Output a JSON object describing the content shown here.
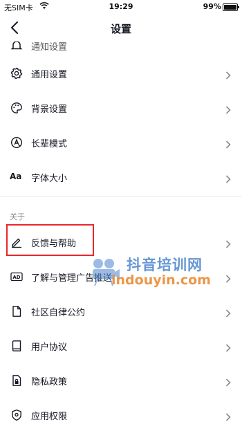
{
  "status_bar": {
    "carrier": "无SIM卡",
    "time": "19:29",
    "battery_percent": "99%",
    "battery_level": 0.99
  },
  "nav": {
    "title": "设置",
    "back_icon": "chevron-left-icon"
  },
  "list": {
    "partial_item": {
      "label": "通知设置",
      "icon": "bell-icon"
    },
    "items_general": [
      {
        "label": "通用设置",
        "icon": "gear-icon"
      },
      {
        "label": "背景设置",
        "icon": "palette-icon"
      },
      {
        "label": "长辈模式",
        "icon": "elder-mode-icon"
      },
      {
        "label": "字体大小",
        "icon": "font-size-icon",
        "icon_text": "Aa"
      }
    ],
    "about_header": "关于",
    "items_about": [
      {
        "label": "反馈与帮助",
        "icon": "pencil-icon"
      },
      {
        "label": "了解与管理广告推送",
        "icon": "ad-icon",
        "icon_text": "AD"
      },
      {
        "label": "社区自律公约",
        "icon": "document-icon"
      },
      {
        "label": "用户协议",
        "icon": "book-icon"
      },
      {
        "label": "隐私政策",
        "icon": "privacy-lock-icon"
      },
      {
        "label": "应用权限",
        "icon": "shield-icon"
      }
    ]
  },
  "annotation": {
    "highlight_color": "#e8262b"
  },
  "watermark": {
    "title": "抖音培训网",
    "url": "indouyin.com"
  },
  "colors": {
    "text": "#161823",
    "secondary_text": "#8a8b91",
    "chevron": "#8a8b91",
    "background": "#ffffff"
  }
}
